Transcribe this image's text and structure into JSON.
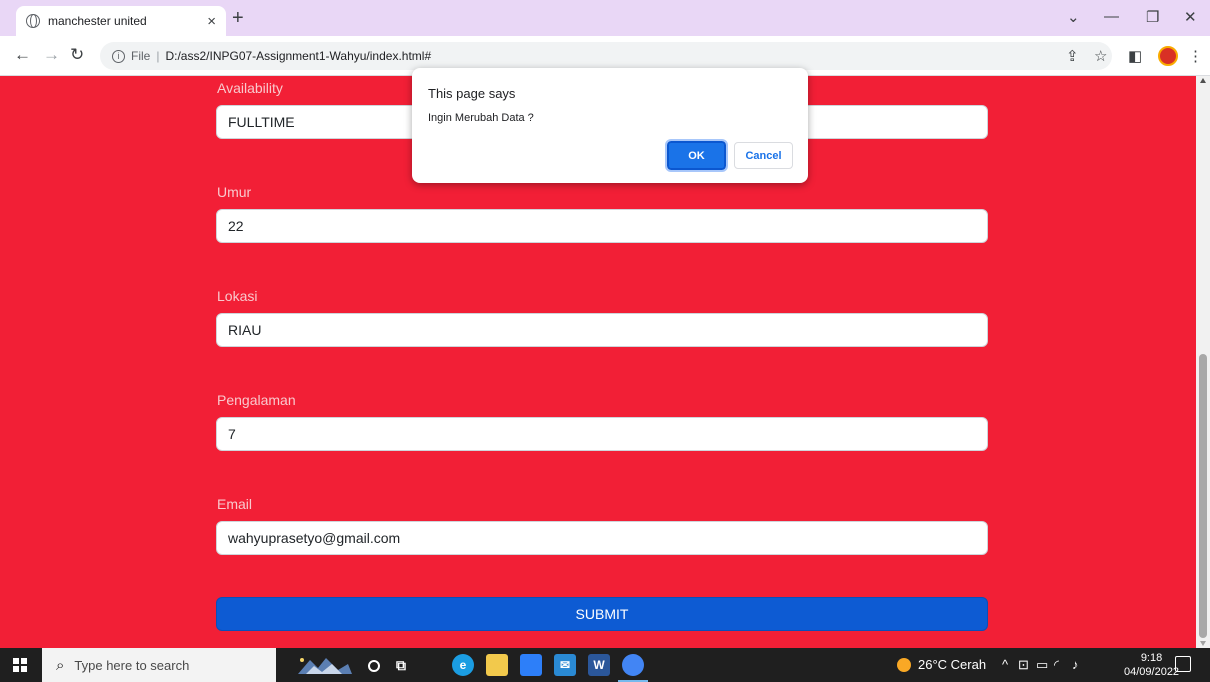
{
  "browser": {
    "tab_title": "manchester united",
    "tab_close": "×",
    "new_tab": "+",
    "url_scheme": "File",
    "url_path": "D:/ass2/INPG07-Assignment1-Wahyu/index.html#"
  },
  "form": {
    "fields": [
      {
        "label": "Availability",
        "value": "FULLTIME"
      },
      {
        "label": "Umur",
        "value": "22"
      },
      {
        "label": "Lokasi",
        "value": "RIAU"
      },
      {
        "label": "Pengalaman",
        "value": "7"
      },
      {
        "label": "Email",
        "value": "wahyuprasetyo@gmail.com"
      }
    ],
    "submit_label": "SUBMIT"
  },
  "dialog": {
    "title": "This page says",
    "message": "Ingin Merubah Data ?",
    "ok_label": "OK",
    "cancel_label": "Cancel"
  },
  "taskbar": {
    "search_placeholder": "Type here to search",
    "weather": "26°C  Cerah",
    "time": "9:18",
    "date": "04/09/2022"
  },
  "colors": {
    "page_background": "#f21f36",
    "submit_button": "#0d5bd3",
    "dialog_ok": "#1a73e8",
    "tab_strip": "#e9d7f6"
  }
}
